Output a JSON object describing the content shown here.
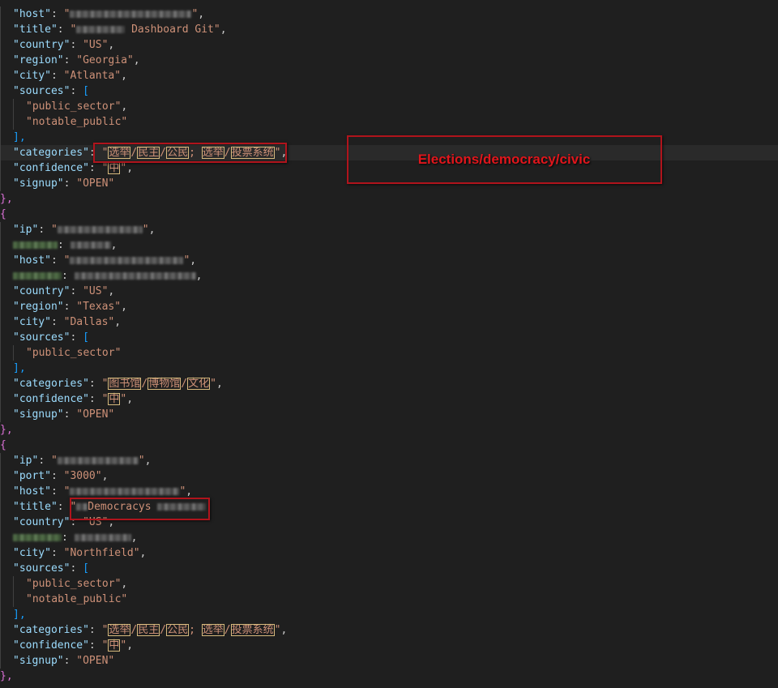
{
  "json_text": {
    "key_ip": "\"ip\"",
    "key_port": "\"port\"",
    "key_host": "\"host\"",
    "key_title": "\"title\"",
    "key_country": "\"country\"",
    "key_region": "\"region\"",
    "key_city": "\"city\"",
    "key_sources": "\"sources\"",
    "key_categories": "\"categories\"",
    "key_confidence": "\"confidence\"",
    "key_signup": "\"signup\"",
    "colon": ": ",
    "comma": ",",
    "quote": "\"",
    "open_brace": "{",
    "close_brace_comma": "},",
    "open_bracket": "[",
    "close_bracket_comma": "],",
    "slash": "/",
    "semicolon": "; "
  },
  "records": [
    {
      "title_visible": " Dashboard Git",
      "country": "\"US\"",
      "region": "\"Georgia\"",
      "city": "\"Atlanta\"",
      "sources": [
        "\"public_sector\"",
        "\"notable_public\""
      ],
      "categories": [
        "选举",
        "民主",
        "公民",
        "选举",
        "投票系统"
      ],
      "confidence": "中",
      "signup": "\"OPEN\""
    },
    {
      "country": "\"US\"",
      "region": "\"Texas\"",
      "city": "\"Dallas\"",
      "sources": [
        "\"public_sector\""
      ],
      "categories": [
        "图书馆",
        "博物馆",
        "文化"
      ],
      "confidence": "中",
      "signup": "\"OPEN\""
    },
    {
      "port": "\"3000\"",
      "title_visible": "Democracys",
      "country": "\"US\"",
      "city": "\"Northfield\"",
      "sources": [
        "\"public_sector\"",
        "\"notable_public\""
      ],
      "categories": [
        "选举",
        "民主",
        "公民",
        "选举",
        "投票系统"
      ],
      "confidence": "中",
      "signup": "\"OPEN\""
    }
  ],
  "annotation": {
    "label": "Elections/democracy/civic",
    "color": "#e0161c"
  },
  "colors": {
    "background": "#1f1f1f",
    "key": "#9cdcfe",
    "string": "#ce9178",
    "brace": "#da70d6",
    "bracket": "#179fff"
  }
}
